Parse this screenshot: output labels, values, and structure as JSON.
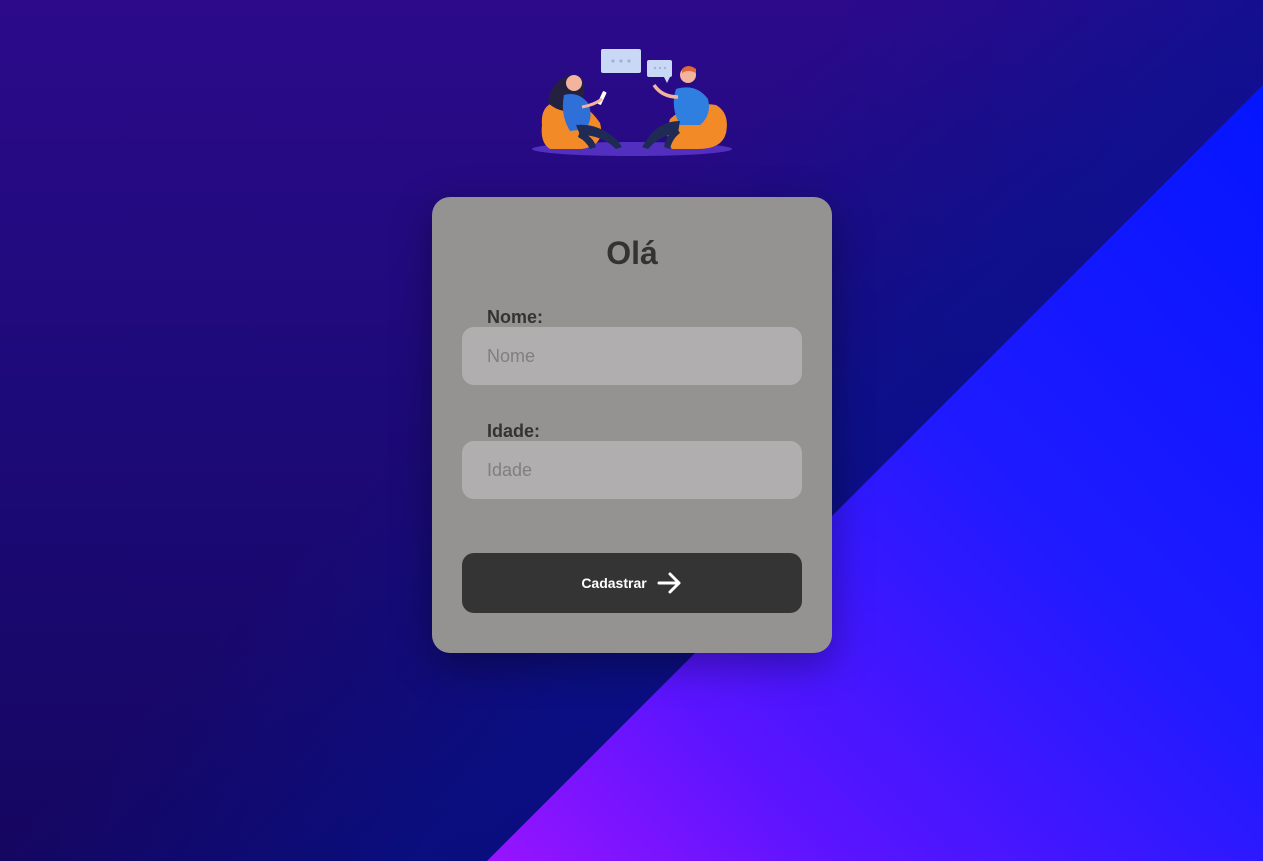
{
  "form": {
    "title": "Olá",
    "fields": [
      {
        "label": "Nome:",
        "placeholder": "Nome",
        "value": ""
      },
      {
        "label": "Idade:",
        "placeholder": "Idade",
        "value": ""
      }
    ],
    "submit_label": "Cadastrar",
    "submit_icon": "arrow-right-icon"
  },
  "illustration": {
    "icon": "people-chatting-illustration"
  },
  "colors": {
    "card_background": "#949392",
    "input_background": "#b0aeae",
    "button_background": "#343434",
    "text_dark": "#333333"
  }
}
